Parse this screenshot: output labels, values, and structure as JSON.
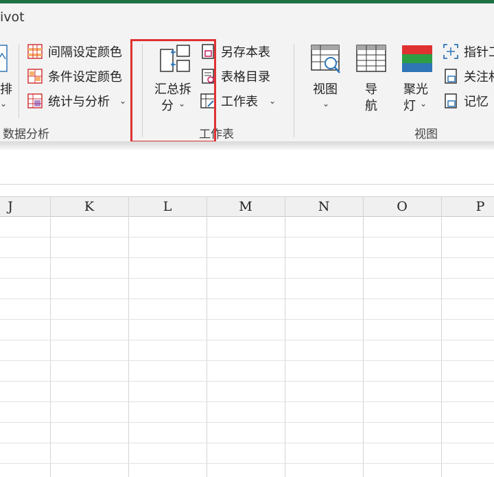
{
  "title_tab": "ivot",
  "ribbon": {
    "data_group": {
      "partial_button": "排",
      "items": [
        "间隔设定颜色",
        "条件设定颜色",
        "统计与分析"
      ],
      "label": "数据分析"
    },
    "sheet_group": {
      "summary_split_line1": "汇总拆",
      "summary_split_line2": "分",
      "items": [
        "另存本表",
        "表格目录",
        "工作表"
      ],
      "label": "工作表"
    },
    "view_group": {
      "view_button": "视图",
      "nav_line1": "导",
      "nav_line2": "航",
      "spotlight_line1": "聚光",
      "spotlight_line2": "灯",
      "side_items": [
        "指针工",
        "关注村",
        "记忆"
      ],
      "label": "视图"
    },
    "chevron": "⌄"
  },
  "columns": [
    "J",
    "K",
    "L",
    "M",
    "N",
    "O",
    "P"
  ],
  "colors": {
    "brand_green": "#1e7145",
    "highlight_red": "#e03131",
    "icon_blue": "#2e75b6",
    "icon_red": "#d13438",
    "icon_purple": "#7b3fa6"
  }
}
